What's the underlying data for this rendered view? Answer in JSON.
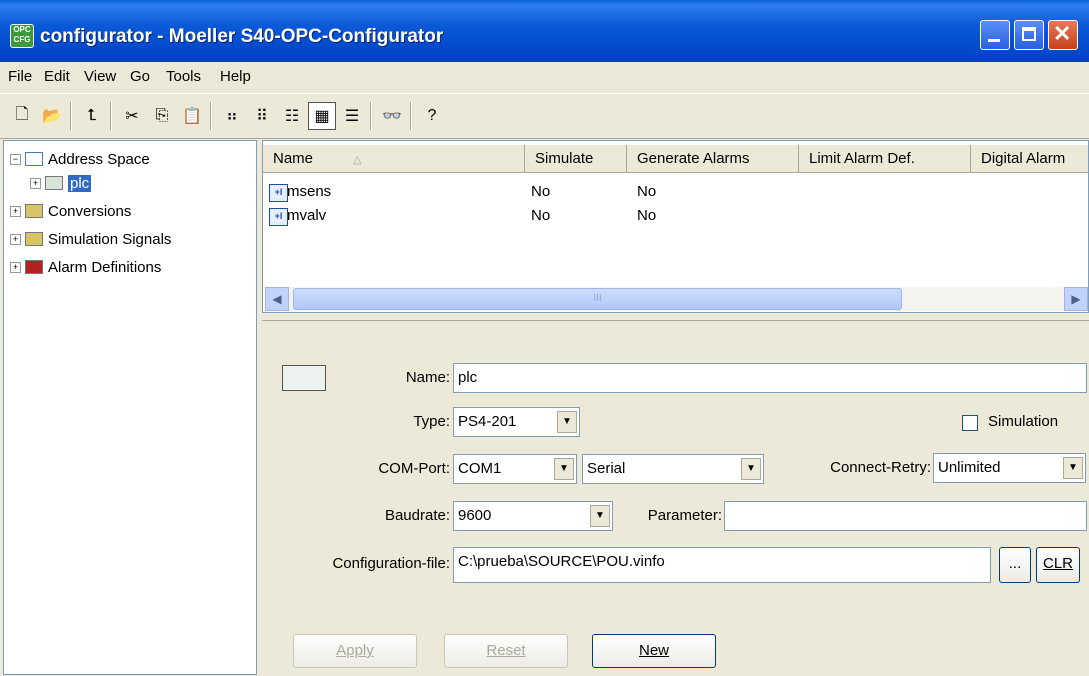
{
  "window": {
    "title": "configurator - Moeller S40-OPC-Configurator",
    "app_icon": "OPC CFG"
  },
  "menu": [
    "File",
    "Edit",
    "View",
    "Go",
    "Tools",
    "Help"
  ],
  "tree": {
    "items": [
      {
        "label": "Address Space",
        "expanded": true
      },
      {
        "label": "plc",
        "selected": true
      },
      {
        "label": "Conversions"
      },
      {
        "label": "Simulation Signals"
      },
      {
        "label": "Alarm Definitions"
      }
    ]
  },
  "list": {
    "columns": [
      "Name",
      "Simulate",
      "Generate Alarms",
      "Limit Alarm Def.",
      "Digital Alarm"
    ],
    "rows": [
      {
        "name": "msens",
        "simulate": "No",
        "generate_alarms": "No"
      },
      {
        "name": "mvalv",
        "simulate": "No",
        "generate_alarms": "No"
      }
    ],
    "scroll_thumb_text": "III"
  },
  "form": {
    "name_label": "Name:",
    "name_value": "plc",
    "type_label": "Type:",
    "type_value": "PS4-201",
    "simulation_label": "Simulation",
    "comport_label": "COM-Port:",
    "comport_value": "COM1",
    "serial_value": "Serial",
    "retry_label": "Connect-Retry:",
    "retry_value": "Unlimited",
    "baud_label": "Baudrate:",
    "baud_value": "9600",
    "param_label": "Parameter:",
    "param_value": "",
    "config_label": "Configuration-file:",
    "config_value": "C:\\prueba\\SOURCE\\POU.vinfo",
    "browse_label": "...",
    "clr_label": "CLR",
    "apply_label": "Apply",
    "reset_label": "Reset",
    "new_label": "New"
  }
}
